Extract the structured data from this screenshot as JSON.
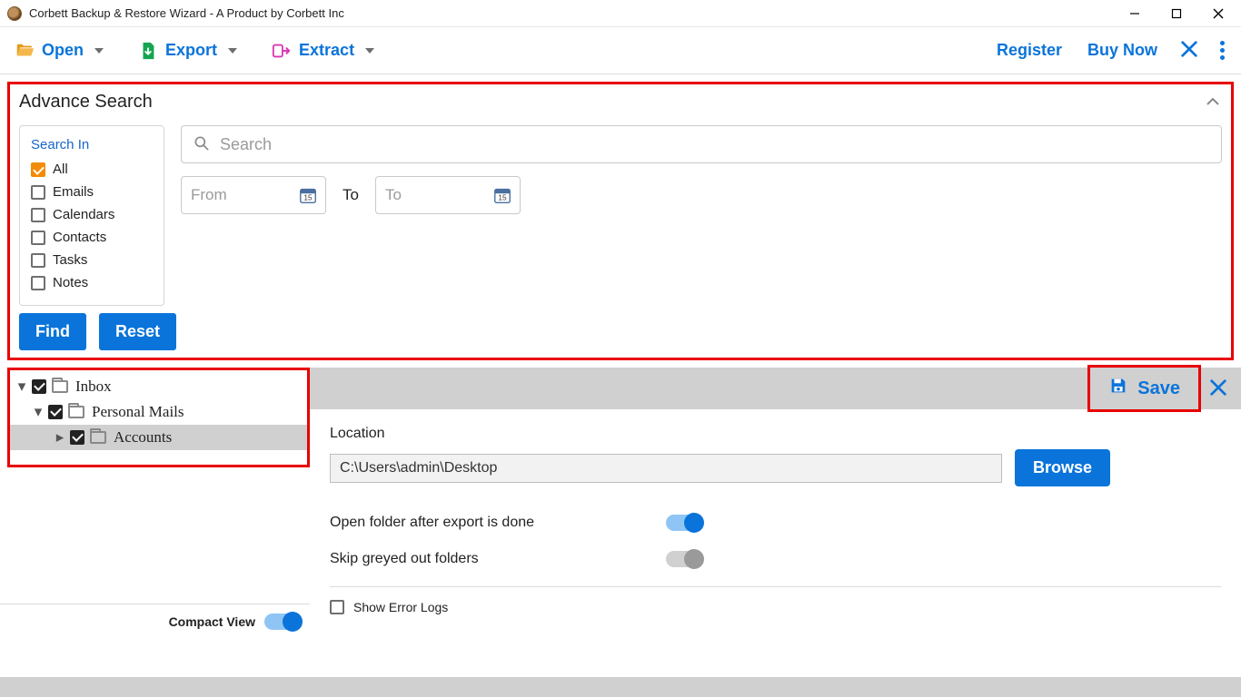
{
  "window": {
    "title": "Corbett Backup & Restore Wizard - A Product by Corbett Inc"
  },
  "toolbar": {
    "open": "Open",
    "export": "Export",
    "extract": "Extract",
    "register": "Register",
    "buy_now": "Buy Now"
  },
  "advance": {
    "title": "Advance Search",
    "search_in": "Search In",
    "items": {
      "all": "All",
      "emails": "Emails",
      "calendars": "Calendars",
      "contacts": "Contacts",
      "tasks": "Tasks",
      "notes": "Notes"
    },
    "search_placeholder": "Search",
    "from_placeholder": "From",
    "to_label": "To",
    "to_placeholder": "To",
    "find": "Find",
    "reset": "Reset"
  },
  "tree": {
    "inbox": "Inbox",
    "personal": "Personal Mails",
    "accounts": "Accounts"
  },
  "compact_view": "Compact View",
  "save_label": "Save",
  "export_opts": {
    "location_label": "Location",
    "location_value": "C:\\Users\\admin\\Desktop",
    "browse": "Browse",
    "open_folder": "Open folder after export is done",
    "skip_greyed": "Skip greyed out folders",
    "show_error_logs": "Show Error Logs"
  }
}
